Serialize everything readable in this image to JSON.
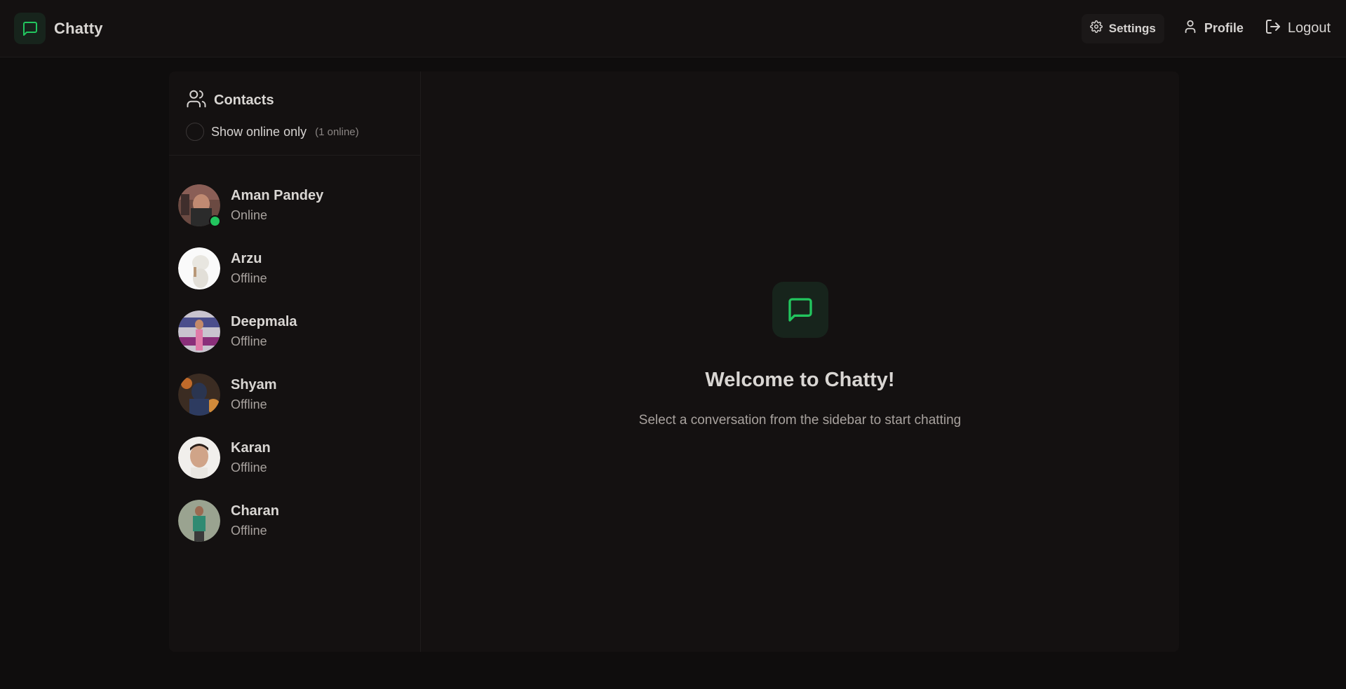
{
  "app": {
    "name": "Chatty"
  },
  "nav": {
    "settings_label": "Settings",
    "profile_label": "Profile",
    "logout_label": "Logout"
  },
  "sidebar": {
    "title": "Contacts",
    "toggle_label": "Show online only",
    "online_count": "(1 online)",
    "contacts": [
      {
        "name": "Aman Pandey",
        "status": "Online"
      },
      {
        "name": "Arzu",
        "status": "Offline"
      },
      {
        "name": "Deepmala",
        "status": "Offline"
      },
      {
        "name": "Shyam",
        "status": "Offline"
      },
      {
        "name": "Karan",
        "status": "Offline"
      },
      {
        "name": "Charan",
        "status": "Offline"
      }
    ]
  },
  "chat": {
    "welcome_title": "Welcome to Chatty!",
    "welcome_subtitle": "Select a conversation from the sidebar to start chatting"
  },
  "colors": {
    "accent": "#22c55e",
    "background": "#0f0d0d",
    "panel": "#141111"
  }
}
